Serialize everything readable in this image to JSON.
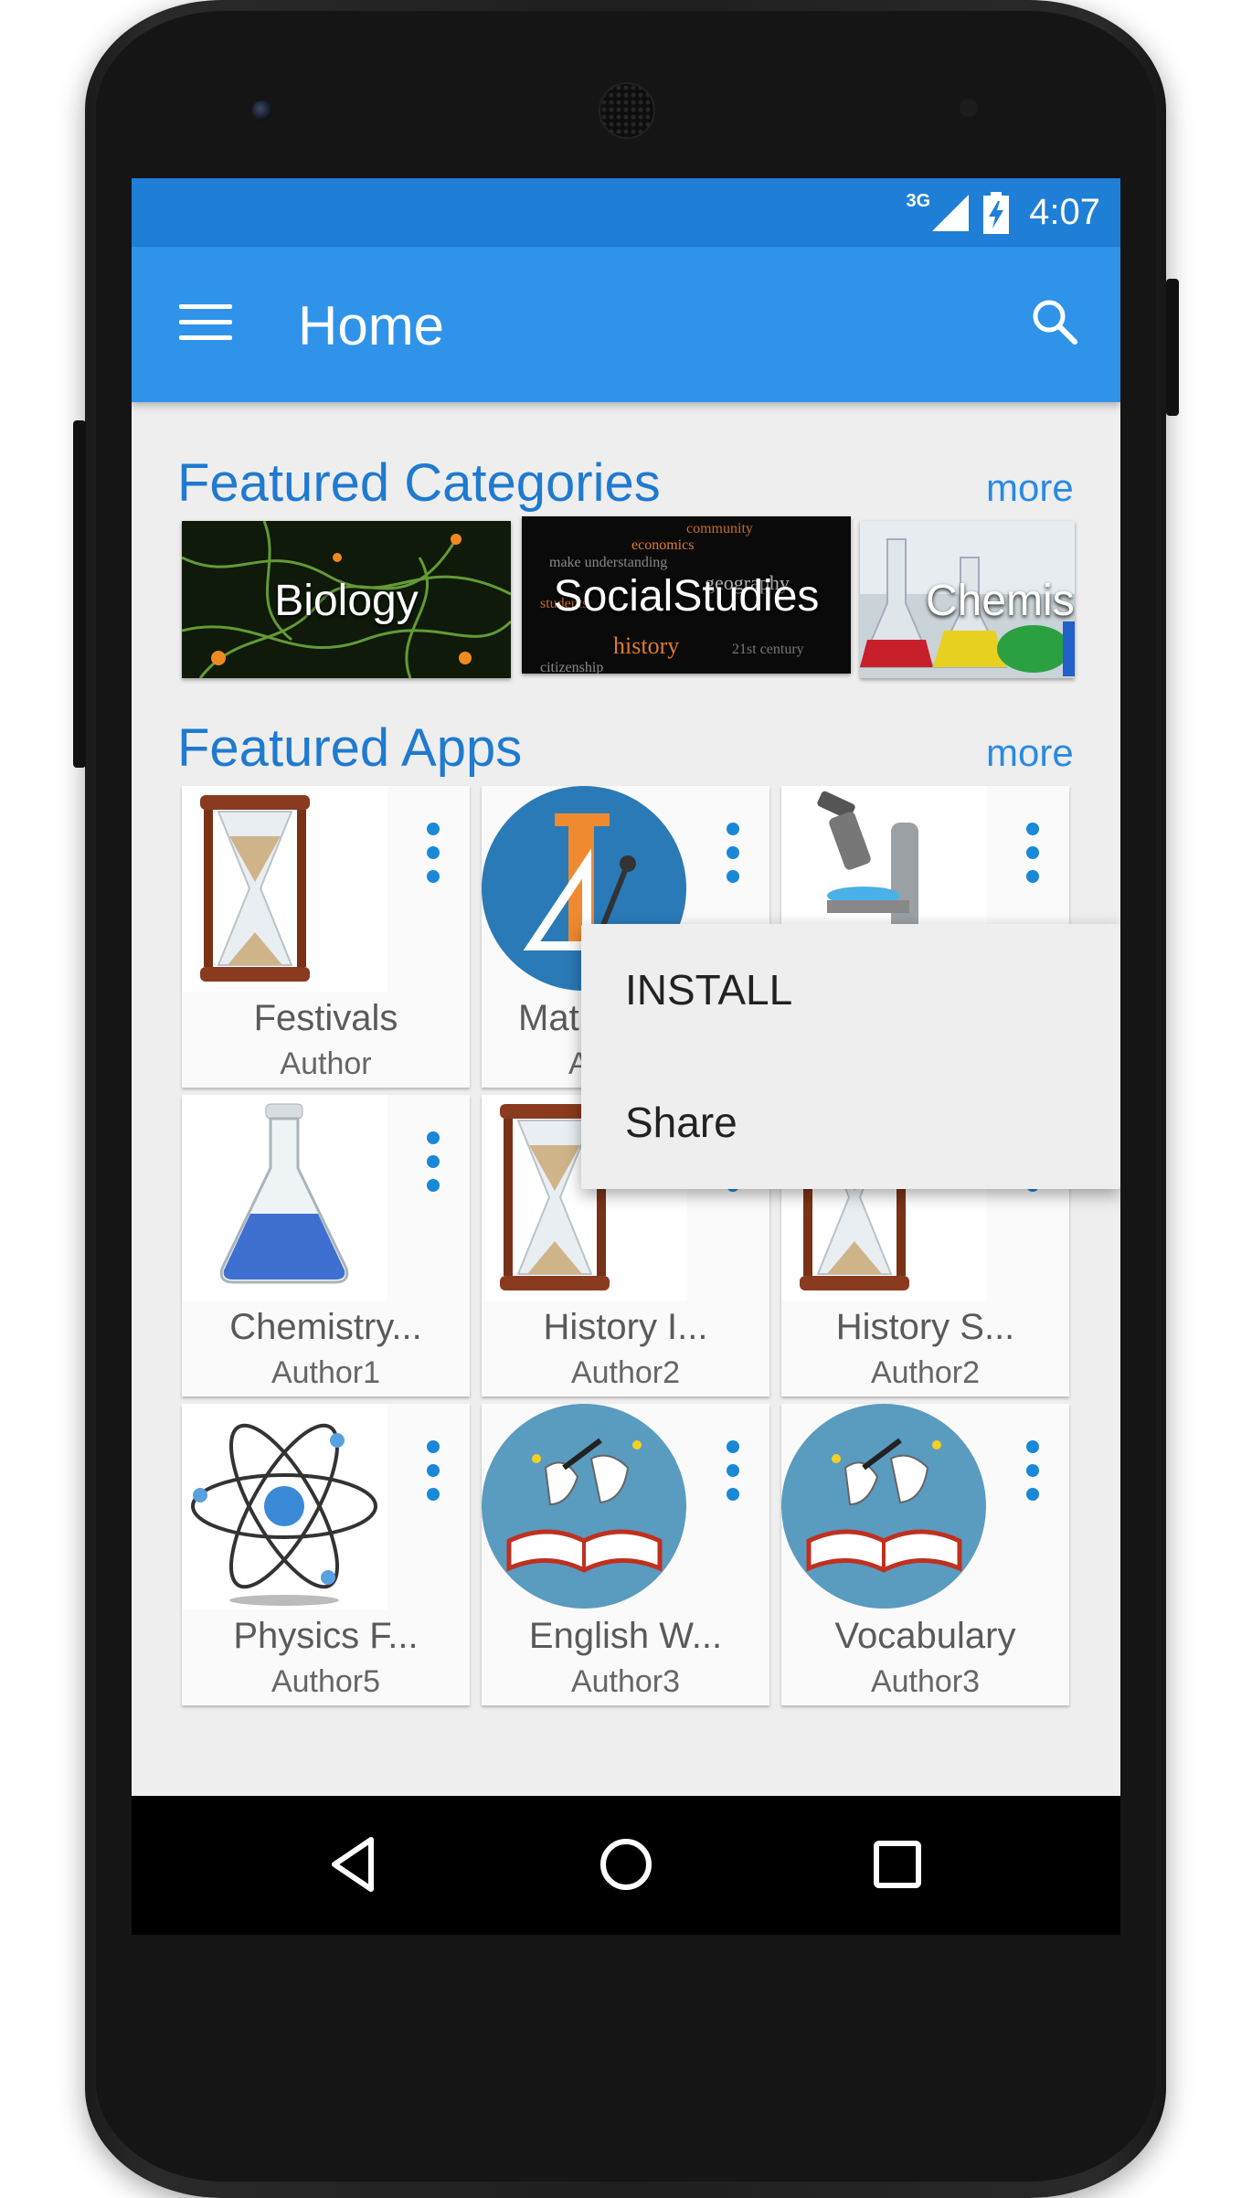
{
  "status": {
    "network": "3G",
    "time": "4:07"
  },
  "appbar": {
    "title": "Home"
  },
  "featured_categories": {
    "title": "Featured Categories",
    "more": "more",
    "items": [
      {
        "label": "Biology"
      },
      {
        "label": "SocialStudies"
      },
      {
        "label": "Chemis"
      }
    ]
  },
  "featured_apps": {
    "title": "Featured Apps",
    "more": "more",
    "items": [
      {
        "name": "Festivals",
        "author": "Author"
      },
      {
        "name": "Mat",
        "author": "A"
      },
      {
        "name": "",
        "author": ""
      },
      {
        "name": "Chemistry...",
        "author": "Author1"
      },
      {
        "name": "History I...",
        "author": "Author2"
      },
      {
        "name": "History S...",
        "author": "Author2"
      },
      {
        "name": "Physics F...",
        "author": "Author5"
      },
      {
        "name": "English W...",
        "author": "Author3"
      },
      {
        "name": "Vocabulary",
        "author": "Author3"
      }
    ]
  },
  "popup_menu": {
    "items": [
      "INSTALL",
      "Share"
    ]
  },
  "colors": {
    "statusbar": "#1f7fd6",
    "appbar": "#2f93ea",
    "accent": "#1f7ad0"
  },
  "icons": [
    "menu-icon",
    "search-icon",
    "more-vert-icon",
    "back-icon",
    "home-icon",
    "recents-icon"
  ]
}
